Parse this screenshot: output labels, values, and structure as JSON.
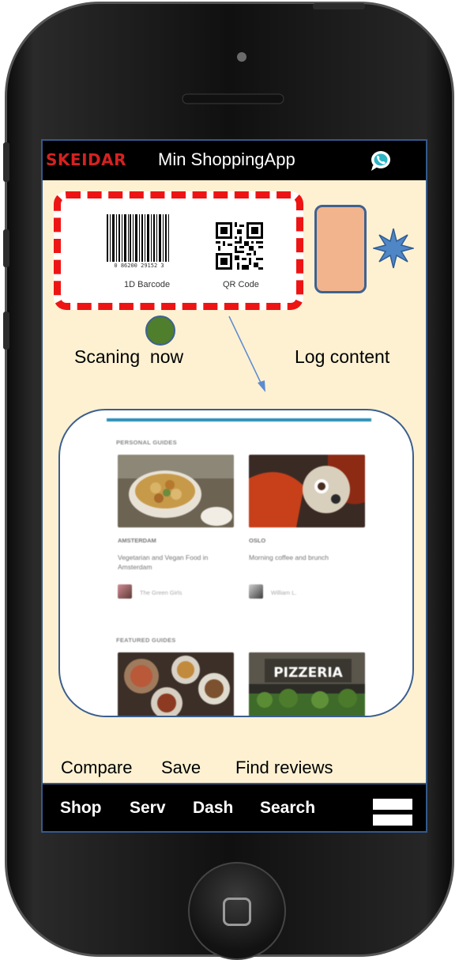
{
  "header": {
    "brand": "SKEIDAR",
    "title": "Min ShoppingApp",
    "chat_icon": "chat-bubble-icon"
  },
  "scanner": {
    "barcode_label": "1D Barcode",
    "qr_label": "QR Code",
    "status_label": "Scaning  now",
    "log_label": "Log content",
    "status_color": "#4f7e2c",
    "frame_color": "#ee1414",
    "log_color": "#f2b48c"
  },
  "preview": {
    "personal_heading": "PERSONAL GUIDES",
    "featured_heading": "FEATURED GUIDES",
    "guides": [
      {
        "city": "AMSTERDAM",
        "desc": "Vegetarian and Vegan Food in Amsterdam",
        "author": "The Green Girls"
      },
      {
        "city": "OSLO",
        "desc": "Morning coffee and brunch",
        "author": "William L."
      }
    ],
    "featured_sign": "PIZZERIA"
  },
  "actions": {
    "compare": "Compare",
    "save": "Save",
    "find_reviews": "Find reviews"
  },
  "nav": {
    "shop": "Shop",
    "serv": "Serv",
    "dash": "Dash",
    "search": "Search"
  }
}
